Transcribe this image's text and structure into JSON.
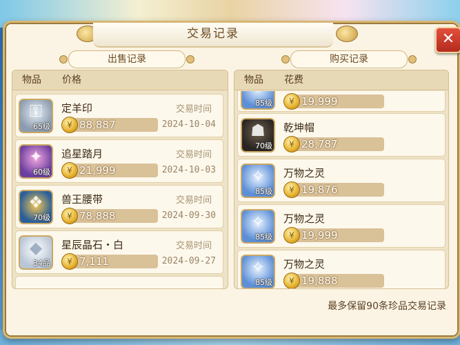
{
  "dialog": {
    "title": "交易记录",
    "close_label": "✕"
  },
  "sell": {
    "header": "出售记录",
    "col_item": "物品",
    "col_price": "价格",
    "rows": [
      {
        "name": "定羊印",
        "level": "65级",
        "price": "88,887",
        "time_label": "交易时间",
        "date": "2024-10-04",
        "icon": "seal-icon"
      },
      {
        "name": "追星踏月",
        "level": "60级",
        "price": "21,999",
        "time_label": "交易时间",
        "date": "2024-10-03",
        "icon": "boots-icon"
      },
      {
        "name": "兽王腰带",
        "level": "70级",
        "price": "78,888",
        "time_label": "交易时间",
        "date": "2024-09-30",
        "icon": "belt-icon"
      },
      {
        "name": "星辰晶石・白",
        "level": "34品",
        "price": "7,111",
        "time_label": "交易时间",
        "date": "2024-09-27",
        "icon": "crystal-icon"
      }
    ]
  },
  "buy": {
    "header": "购买记录",
    "col_item": "物品",
    "col_cost": "花费",
    "rows": [
      {
        "name": "",
        "level": "85级",
        "price": "19,999",
        "icon": "spirit-icon"
      },
      {
        "name": "乾坤帽",
        "level": "70级",
        "price": "28,787",
        "icon": "hat-icon"
      },
      {
        "name": "万物之灵",
        "level": "85级",
        "price": "19,876",
        "icon": "spirit-icon"
      },
      {
        "name": "万物之灵",
        "level": "85级",
        "price": "19,999",
        "icon": "spirit-icon"
      },
      {
        "name": "万物之灵",
        "level": "85级",
        "price": "19,888",
        "icon": "spirit-icon"
      }
    ]
  },
  "footer": {
    "note": "最多保留90条珍品交易记录"
  },
  "coin_glyph": "¥"
}
